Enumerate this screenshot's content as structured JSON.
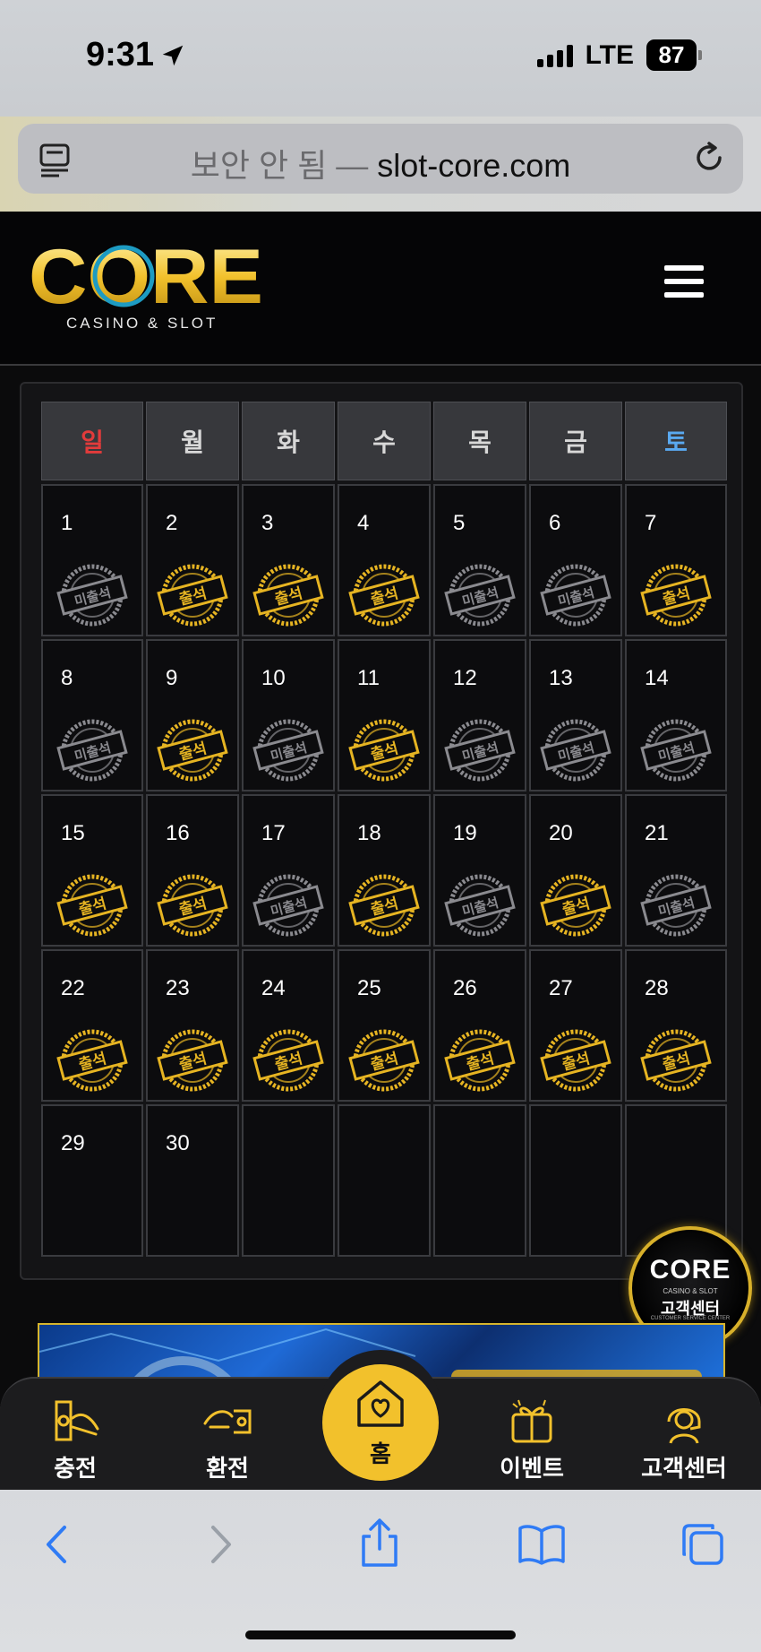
{
  "status_bar": {
    "time": "9:31",
    "network": "LTE",
    "battery": "87"
  },
  "browser": {
    "address_warning": "보안 안 됨 —",
    "address_domain": "slot-core.com"
  },
  "site": {
    "logo_text": "CORE",
    "logo_subtitle": "CASINO & SLOT"
  },
  "calendar": {
    "weekdays": [
      "일",
      "월",
      "화",
      "수",
      "목",
      "금",
      "토"
    ],
    "weekday_colors": {
      "sunday": "#e23b3b",
      "saturday": "#5aa9f0",
      "weekday": "#d8d8d8"
    },
    "stamp_labels": {
      "attended": "출석",
      "absent": "미출석"
    },
    "days": [
      {
        "day": "1",
        "status": "absent"
      },
      {
        "day": "2",
        "status": "attended"
      },
      {
        "day": "3",
        "status": "attended"
      },
      {
        "day": "4",
        "status": "attended"
      },
      {
        "day": "5",
        "status": "absent"
      },
      {
        "day": "6",
        "status": "absent"
      },
      {
        "day": "7",
        "status": "attended"
      },
      {
        "day": "8",
        "status": "absent"
      },
      {
        "day": "9",
        "status": "attended"
      },
      {
        "day": "10",
        "status": "absent"
      },
      {
        "day": "11",
        "status": "attended"
      },
      {
        "day": "12",
        "status": "absent"
      },
      {
        "day": "13",
        "status": "absent"
      },
      {
        "day": "14",
        "status": "absent"
      },
      {
        "day": "15",
        "status": "attended"
      },
      {
        "day": "16",
        "status": "attended"
      },
      {
        "day": "17",
        "status": "absent"
      },
      {
        "day": "18",
        "status": "attended"
      },
      {
        "day": "19",
        "status": "absent"
      },
      {
        "day": "20",
        "status": "attended"
      },
      {
        "day": "21",
        "status": "absent"
      },
      {
        "day": "22",
        "status": "attended"
      },
      {
        "day": "23",
        "status": "attended"
      },
      {
        "day": "24",
        "status": "attended"
      },
      {
        "day": "25",
        "status": "attended"
      },
      {
        "day": "26",
        "status": "attended"
      },
      {
        "day": "27",
        "status": "attended"
      },
      {
        "day": "28",
        "status": "attended"
      },
      {
        "day": "29",
        "status": "none"
      },
      {
        "day": "30",
        "status": "none"
      },
      {
        "day": "",
        "status": "none"
      },
      {
        "day": "",
        "status": "none"
      },
      {
        "day": "",
        "status": "none"
      },
      {
        "day": "",
        "status": "none"
      },
      {
        "day": "",
        "status": "none"
      }
    ]
  },
  "customer_center_badge": {
    "logo": "CORE",
    "small_text": "CASINO & SLOT",
    "label": "고객센터",
    "subtext": "CUSTOMER SERVICE CENTER"
  },
  "bottom_nav": {
    "deposit": "충전",
    "withdraw": "환전",
    "home": "홈",
    "events": "이벤트",
    "support": "고객센터"
  },
  "colors": {
    "gold": "#f2c12c",
    "stamp_gold": "#e6b422",
    "stamp_gray": "#8a8a8f"
  },
  "icons": [
    "location-arrow-icon",
    "signal-icon",
    "battery-icon",
    "reader-mode-icon",
    "reload-icon",
    "hamburger-menu-icon",
    "deposit-icon",
    "withdraw-icon",
    "home-heart-icon",
    "gift-icon",
    "headset-icon",
    "back-icon",
    "forward-icon",
    "share-icon",
    "bookmarks-icon",
    "tabs-icon"
  ]
}
